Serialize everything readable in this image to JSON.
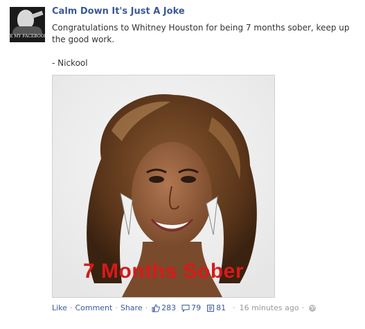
{
  "post": {
    "page_name": "Calm Down It's Just A Joke",
    "avatar_text": "E MY FACEBOOK P",
    "message_line": "Congratulations to Whitney Houston for being 7 months sober, keep up the good work.",
    "signature": "- Nickool",
    "image_overlay": "7 Months Sober"
  },
  "actions": {
    "like": "Like",
    "comment": "Comment",
    "share": "Share",
    "likes_count": "283",
    "comments_count": "79",
    "shares_count": "81",
    "timestamp": "16 minutes ago"
  },
  "colors": {
    "link": "#3b5998",
    "text": "#333333",
    "meta": "#999999",
    "overlay": "#d81a1a"
  },
  "icons": [
    "thumbs-up-icon",
    "comment-bubble-icon",
    "share-icon",
    "globe-icon"
  ]
}
